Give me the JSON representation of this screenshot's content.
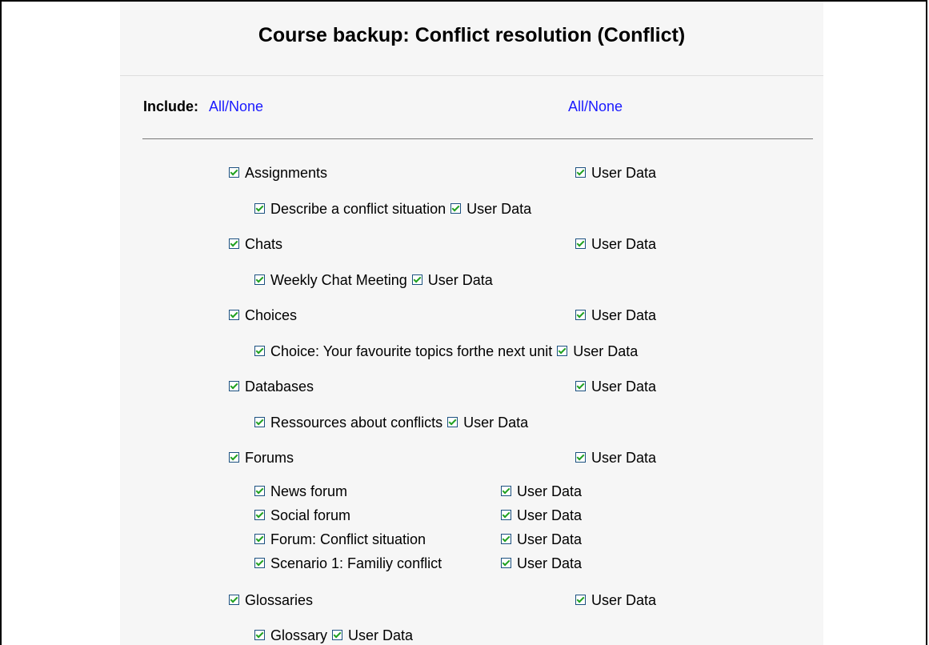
{
  "page": {
    "title": "Course backup: Conflict resolution (Conflict)",
    "include_label": "Include:",
    "all_none_left": "All/None",
    "all_none_right": "All/None",
    "user_data_label": "User Data"
  },
  "modules": [
    {
      "name": "Assignments",
      "checked": true,
      "user_data": true,
      "instances": [
        {
          "name": "Describe a conflict situation",
          "checked": true,
          "user_data": true
        }
      ]
    },
    {
      "name": "Chats",
      "checked": true,
      "user_data": true,
      "instances": [
        {
          "name": "Weekly Chat Meeting",
          "checked": true,
          "user_data": true
        }
      ]
    },
    {
      "name": "Choices",
      "checked": true,
      "user_data": true,
      "instances": [
        {
          "name": "Choice: Your favourite topics forthe next unit",
          "checked": true,
          "user_data": true
        }
      ]
    },
    {
      "name": "Databases",
      "checked": true,
      "user_data": true,
      "instances": [
        {
          "name": "Ressources about conflicts",
          "checked": true,
          "user_data": true
        }
      ]
    },
    {
      "name": "Forums",
      "checked": true,
      "user_data": true,
      "instances": [
        {
          "name": "News forum",
          "checked": true,
          "user_data": true
        },
        {
          "name": "Social forum",
          "checked": true,
          "user_data": true
        },
        {
          "name": "Forum: Conflict situation",
          "checked": true,
          "user_data": true
        },
        {
          "name": "Scenario 1: Familiy conflict",
          "checked": true,
          "user_data": true
        }
      ]
    },
    {
      "name": "Glossaries",
      "checked": true,
      "user_data": true,
      "instances": [
        {
          "name": "Glossary",
          "checked": true,
          "user_data": true
        }
      ]
    }
  ],
  "colors": {
    "link": "#1a1aff",
    "check": "#21a121",
    "checkbox_border": "#1c5180",
    "panel_bg": "#f6f6f6"
  }
}
